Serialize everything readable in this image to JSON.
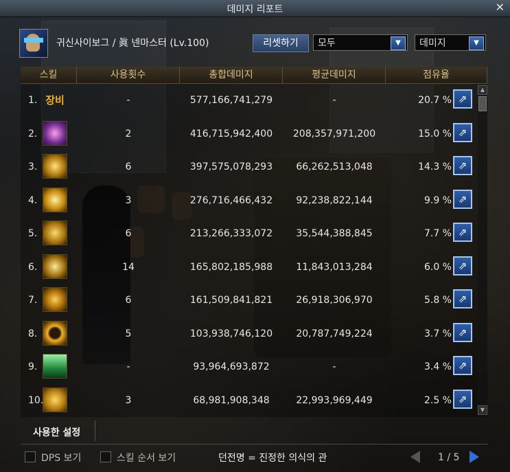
{
  "window": {
    "title": "데미지 리포트",
    "close_label": "✕"
  },
  "character": {
    "name": "귀신사이보그 / 眞 넨마스터 (Lv.100)"
  },
  "controls": {
    "reset_label": "리셋하기",
    "filter_value": "모두",
    "sort_value": "데미지",
    "dropdown_arrow": "▼"
  },
  "table": {
    "headers": [
      "스킬",
      "사용횟수",
      "총합데미지",
      "평균데미지",
      "점유율"
    ],
    "rows": [
      {
        "rank": "1.",
        "icon": "equipment-text-icon",
        "icon_text": "장비",
        "uses": "-",
        "total": "577,166,741,279",
        "avg": "-",
        "share": "20.7 %"
      },
      {
        "rank": "2.",
        "icon": "purple-aura-skill-icon",
        "icon_text": "",
        "uses": "2",
        "total": "416,715,942,400",
        "avg": "208,357,971,200",
        "share": "15.0 %"
      },
      {
        "rank": "3.",
        "icon": "spinning-blast-skill-icon",
        "icon_text": "",
        "uses": "6",
        "total": "397,575,078,293",
        "avg": "66,262,513,048",
        "share": "14.3 %"
      },
      {
        "rank": "4.",
        "icon": "light-pillar-skill-icon",
        "icon_text": "",
        "uses": "3",
        "total": "276,716,466,432",
        "avg": "92,238,822,144",
        "share": "9.9 %"
      },
      {
        "rank": "5.",
        "icon": "dragon-claw-skill-icon",
        "icon_text": "",
        "uses": "6",
        "total": "213,266,333,072",
        "avg": "35,544,388,845",
        "share": "7.7 %"
      },
      {
        "rank": "6.",
        "icon": "nen-orb-skill-icon",
        "icon_text": "",
        "uses": "14",
        "total": "165,802,185,988",
        "avg": "11,843,013,284",
        "share": "6.0 %"
      },
      {
        "rank": "7.",
        "icon": "orbit-skill-icon",
        "icon_text": "",
        "uses": "6",
        "total": "161,509,841,821",
        "avg": "26,918,306,970",
        "share": "5.8 %"
      },
      {
        "rank": "8.",
        "icon": "sun-ring-skill-icon",
        "icon_text": "",
        "uses": "5",
        "total": "103,938,746,120",
        "avg": "20,787,749,224",
        "share": "3.7 %"
      },
      {
        "rank": "9.",
        "icon": "green-tower-skill-icon",
        "icon_text": "",
        "uses": "-",
        "total": "93,964,693,872",
        "avg": "-",
        "share": "3.4 %"
      },
      {
        "rank": "10.",
        "icon": "lion-head-skill-icon",
        "icon_text": "",
        "uses": "3",
        "total": "68,981,908,348",
        "avg": "22,993,969,449",
        "share": "2.5 %"
      }
    ],
    "share_button_glyph": "⇗"
  },
  "settings": {
    "label": "사용한 설정"
  },
  "footer": {
    "dps_label": "DPS 보기",
    "skill_order_label": "스킬 순서 보기",
    "equipment_text": "던전명 = 진정한 의식의 관",
    "page_text": "1 / 5"
  },
  "colors": {
    "header_text": "#d9c089",
    "share_button": "#2e5ea8",
    "next_arrow": "#3070d8"
  }
}
